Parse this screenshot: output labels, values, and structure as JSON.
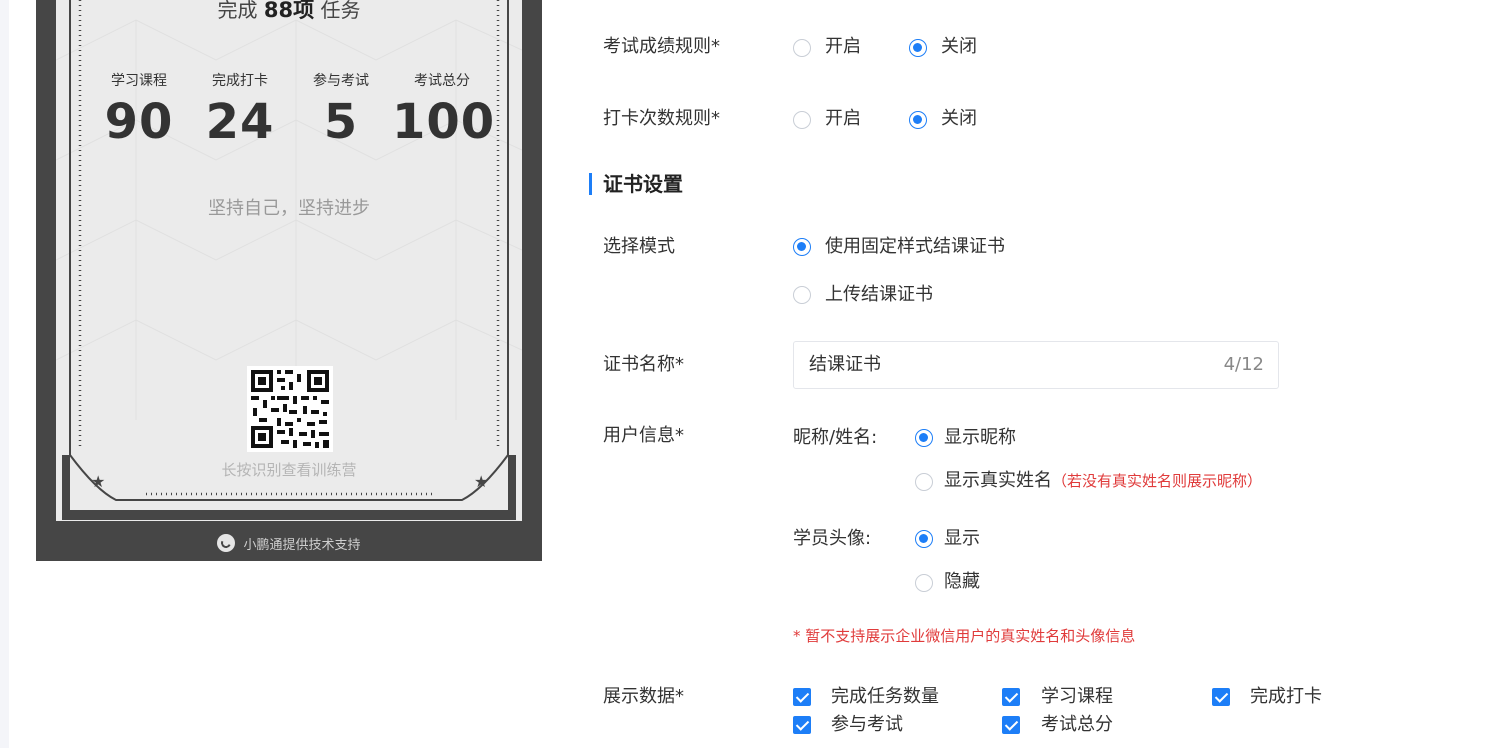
{
  "certificate_preview": {
    "task_prefix": "完成",
    "task_count": "88项",
    "task_suffix": "任务",
    "stats": [
      {
        "label": "学习课程",
        "value": "90"
      },
      {
        "label": "完成打卡",
        "value": "24"
      },
      {
        "label": "参与考试",
        "value": "5"
      },
      {
        "label": "考试总分",
        "value": "100"
      }
    ],
    "motto": "坚持自己，坚持进步",
    "qr_hint": "长按识别查看训练营",
    "footer": "小鹏通提供技术支持"
  },
  "form": {
    "exam_rule": {
      "label": "考试成绩规则*",
      "options": [
        {
          "label": "开启",
          "checked": false
        },
        {
          "label": "关闭",
          "checked": true
        }
      ]
    },
    "checkin_rule": {
      "label": "打卡次数规则*",
      "options": [
        {
          "label": "开启",
          "checked": false
        },
        {
          "label": "关闭",
          "checked": true
        }
      ]
    },
    "section_title": "证书设置",
    "mode": {
      "label": "选择模式",
      "options": [
        {
          "label": "使用固定样式结课证书",
          "checked": true
        },
        {
          "label": "上传结课证书",
          "checked": false
        }
      ]
    },
    "cert_name": {
      "label": "证书名称*",
      "value": "结课证书",
      "count": "4/12"
    },
    "user_info": {
      "label": "用户信息*",
      "name_label": "昵称/姓名:",
      "name_options": [
        {
          "label": "显示昵称",
          "checked": true
        },
        {
          "label": "显示真实姓名",
          "checked": false
        }
      ],
      "name_hint": "（若没有真实姓名则展示昵称）",
      "avatar_label": "学员头像:",
      "avatar_options": [
        {
          "label": "显示",
          "checked": true
        },
        {
          "label": "隐藏",
          "checked": false
        }
      ],
      "warning": "* 暂不支持展示企业微信用户的真实姓名和头像信息"
    },
    "display_data": {
      "label": "展示数据*",
      "items": [
        {
          "label": "完成任务数量",
          "checked": true
        },
        {
          "label": "学习课程",
          "checked": true
        },
        {
          "label": "完成打卡",
          "checked": true
        },
        {
          "label": "参与考试",
          "checked": true
        },
        {
          "label": "考试总分",
          "checked": true
        }
      ]
    }
  },
  "colors": {
    "accent": "#1d7ef7",
    "warning": "#e03b3b",
    "frame": "#464646",
    "paper": "#ebebeb"
  }
}
